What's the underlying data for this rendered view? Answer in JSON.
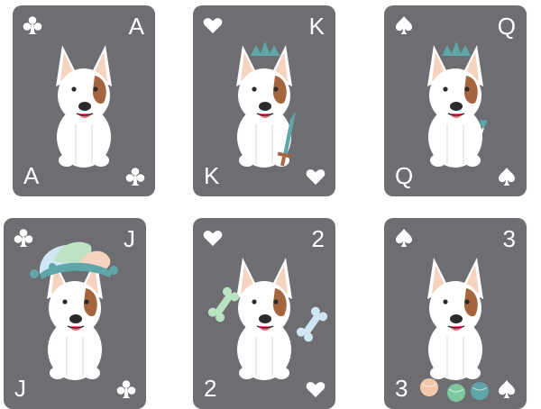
{
  "colors": {
    "card": "#6e6e72",
    "fur": "#ffffff",
    "ear_inner": "#f6d3bf",
    "patch": "#a5653f",
    "crown": "#5ea6a8",
    "bone_mint": "#b9e2c0",
    "bone_blue": "#cfe6f7"
  },
  "cards": [
    {
      "rank": "A",
      "suit": "clubs",
      "suit_icon": "club-icon"
    },
    {
      "rank": "K",
      "suit": "hearts",
      "suit_icon": "heart-icon",
      "accessory": "crown and sword"
    },
    {
      "rank": "Q",
      "suit": "spades",
      "suit_icon": "spade-icon",
      "accessory": "crown and wand"
    },
    {
      "rank": "J",
      "suit": "clubs",
      "suit_icon": "club-icon",
      "accessory": "jester hat"
    },
    {
      "rank": "2",
      "suit": "hearts",
      "suit_icon": "heart-icon",
      "accessory": "two bones"
    },
    {
      "rank": "3",
      "suit": "spades",
      "suit_icon": "spade-icon",
      "accessory": "three balls"
    }
  ]
}
